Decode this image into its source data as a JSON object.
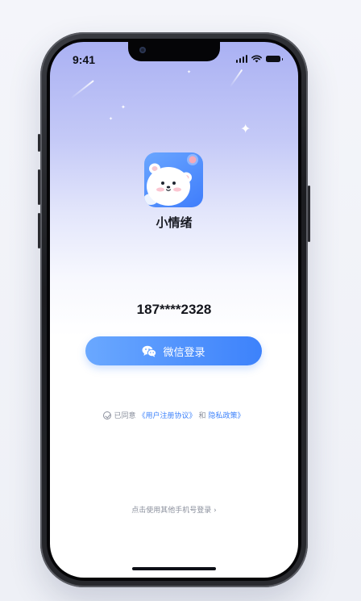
{
  "status_bar": {
    "time": "9:41",
    "signal_icon": "signal-icon",
    "wifi_icon": "wifi-icon",
    "battery_icon": "battery-icon"
  },
  "app": {
    "name": "小情绪",
    "logo_icon": "polar-bear-logo-icon"
  },
  "login": {
    "phone_number": "187****2328",
    "wechat_button_label": "微信登录",
    "wechat_icon": "wechat-icon"
  },
  "agreement": {
    "prefix": "已同意",
    "user_agreement": "《用户注册协议》",
    "and": "和",
    "privacy_policy": "隐私政策》",
    "check_icon": "check-circle-icon"
  },
  "other_login": {
    "label": "点击使用其他手机号登录 ›"
  },
  "colors": {
    "accent": "#3d82fb",
    "button_start": "#6aa8ff",
    "header_top": "#aab1f3",
    "muted_text": "#8a8f9c"
  }
}
